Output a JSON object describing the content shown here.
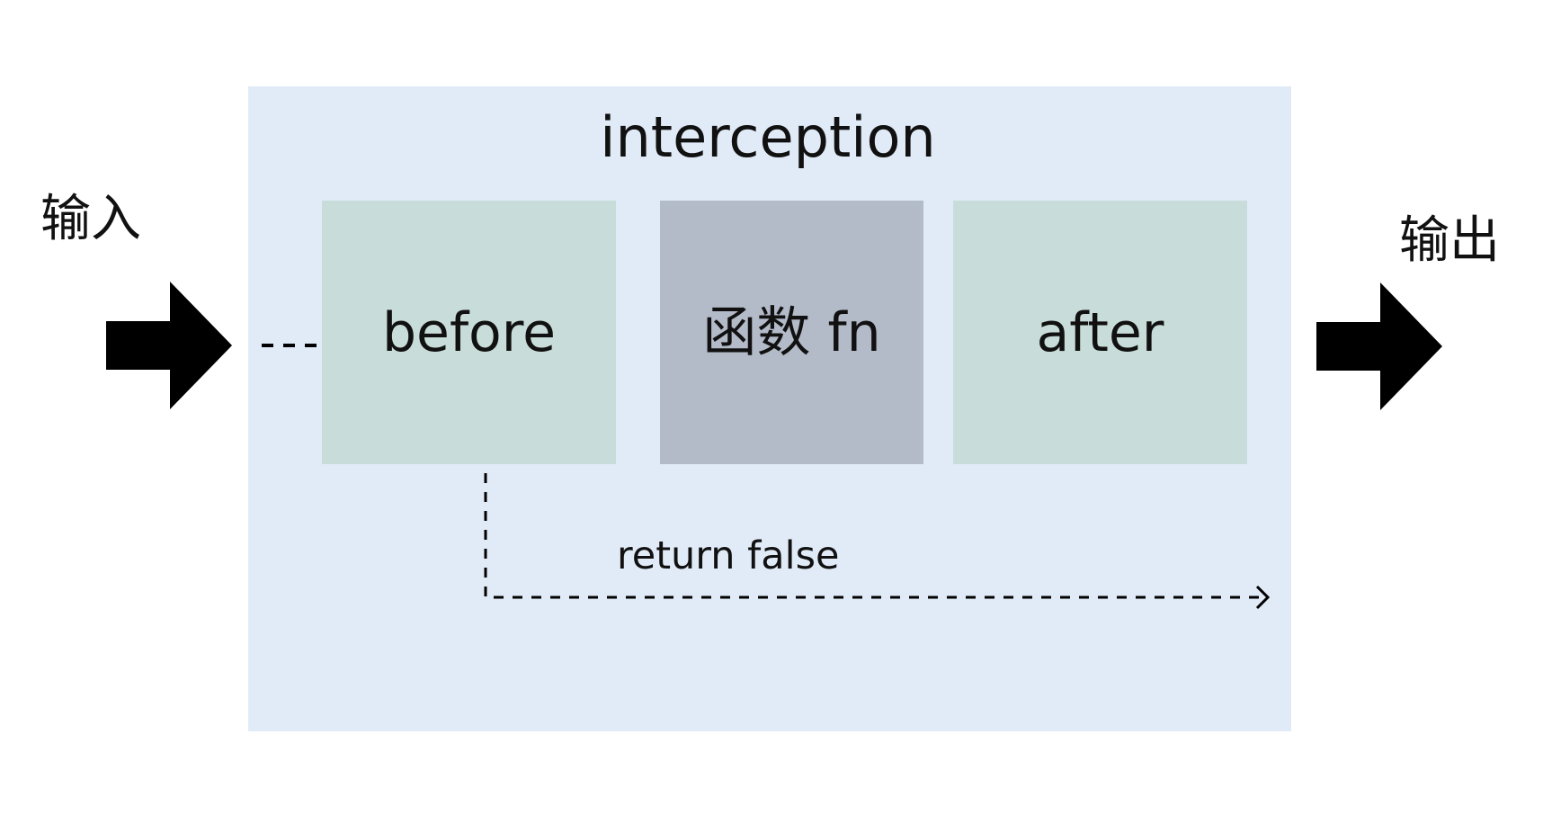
{
  "diagram": {
    "input_label": "输入",
    "output_label": "输出",
    "container_title": "interception",
    "stages": {
      "before": "before",
      "function": "函数 fn",
      "after": "after"
    },
    "bypass_label": "return false",
    "colors": {
      "container_fill": "#e1ebf8",
      "before_after_fill": "#c8ddd9",
      "function_fill": "#b3bac8",
      "arrow_fill": "#000000"
    },
    "icons": {
      "input_arrow": "right-arrow-icon",
      "output_arrow": "right-arrow-icon"
    }
  }
}
